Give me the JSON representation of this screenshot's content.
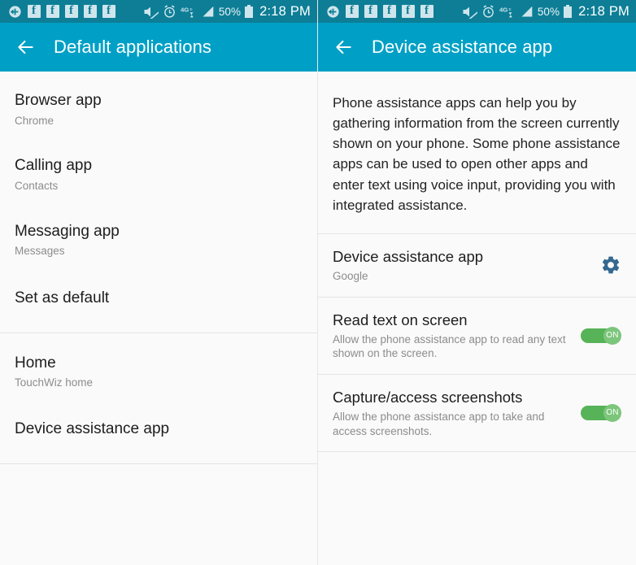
{
  "status_bar": {
    "icons": [
      "add-circle-icon",
      "facebook-icon",
      "facebook-icon",
      "facebook-icon",
      "facebook-icon",
      "facebook-icon",
      "mute-icon",
      "alarm-icon",
      "4g-lte-icon",
      "signal-bars-icon"
    ],
    "battery_percent": "50%",
    "time": "2:18 PM",
    "background_color": "#0d7e96"
  },
  "theme": {
    "accent": "#00a0c6",
    "toggle_on": "#57b357",
    "toggle_thumb": "#7cc67c",
    "gear": "#34688f",
    "page_bg": "#fafafa",
    "divider": "#e4e4e4"
  },
  "left_panel": {
    "appbar": {
      "back_icon": "back-arrow-icon",
      "title": "Default applications"
    },
    "group_1": [
      {
        "title": "Browser app",
        "subtitle": "Chrome"
      },
      {
        "title": "Calling app",
        "subtitle": "Contacts"
      },
      {
        "title": "Messaging app",
        "subtitle": "Messages"
      },
      {
        "title": "Set as default",
        "subtitle": ""
      }
    ],
    "group_2": [
      {
        "title": "Home",
        "subtitle": "TouchWiz home"
      },
      {
        "title": "Device assistance app",
        "subtitle": ""
      }
    ]
  },
  "right_panel": {
    "appbar": {
      "back_icon": "back-arrow-icon",
      "title": "Device assistance app"
    },
    "description": "Phone assistance apps can help you by gathering information from the screen currently shown on your phone. Some phone assistance apps can be used to open other apps and enter text using voice input, providing you with integrated assistance.",
    "rows": [
      {
        "title": "Device assistance app",
        "subtitle": "Google",
        "control": "gear",
        "control_icon": "gear-icon"
      },
      {
        "title": "Read text on screen",
        "subtitle": "Allow the phone assistance app to read any text shown on the screen.",
        "control": "toggle",
        "toggle_label": "ON",
        "toggle_state": "on"
      },
      {
        "title": "Capture/access screenshots",
        "subtitle": "Allow the phone assistance app to take and access screenshots.",
        "control": "toggle",
        "toggle_label": "ON",
        "toggle_state": "on"
      }
    ]
  }
}
